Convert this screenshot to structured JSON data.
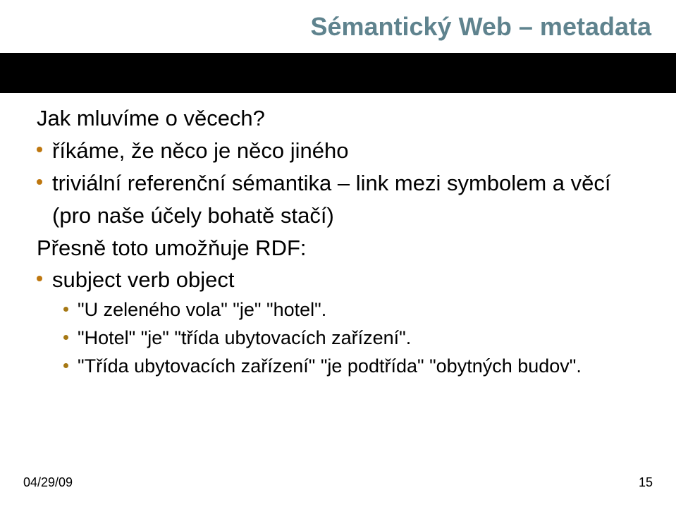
{
  "title": "Sémantický Web – metadata",
  "lines": {
    "l0": "Jak mluvíme o věcech?",
    "l1": "říkáme, že něco je něco jiného",
    "l2": "triviální referenční sémantika – link mezi symbolem a věcí (pro naše účely bohatě stačí)",
    "l3": "Přesně toto umožňuje RDF:",
    "l4": "subject verb object",
    "l5": "\"U zeleného vola\" \"je\" \"hotel\".",
    "l6": "\"Hotel\" \"je\" \"třída ubytovacích zařízení\".",
    "l7": "\"Třída ubytovacích zařízení\" \"je podtřída\" \"obytných budov\"."
  },
  "footer": {
    "date": "04/29/09",
    "page": "15"
  }
}
